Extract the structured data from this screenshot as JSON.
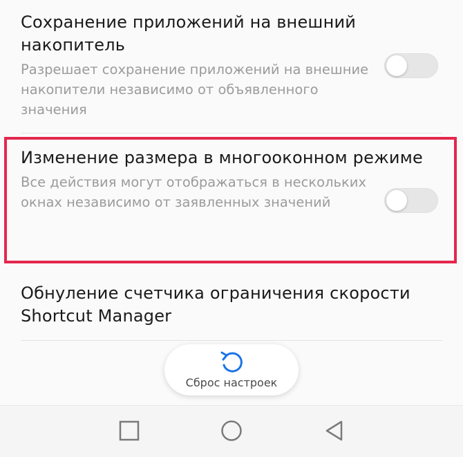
{
  "settings": [
    {
      "title": "Сохранение приложений на внешний накопитель",
      "description": "Разрешает сохранение приложений на внешние накопители независимо от объявленного значения",
      "enabled": false
    },
    {
      "title": "Изменение размера в многооконном режиме",
      "description": "Все действия могут отображаться в нескольких окнах независимо от заявленных значений",
      "enabled": false
    },
    {
      "title": "Обнуление счетчика ограничения скорости Shortcut Manager"
    }
  ],
  "reset": {
    "label": "Сброс настроек",
    "icon": "refresh-icon"
  },
  "navbar": {
    "icons": [
      "recent-apps-icon",
      "home-icon",
      "back-icon"
    ]
  },
  "colors": {
    "highlight": "#e3274e",
    "accent": "#1a73e8"
  }
}
